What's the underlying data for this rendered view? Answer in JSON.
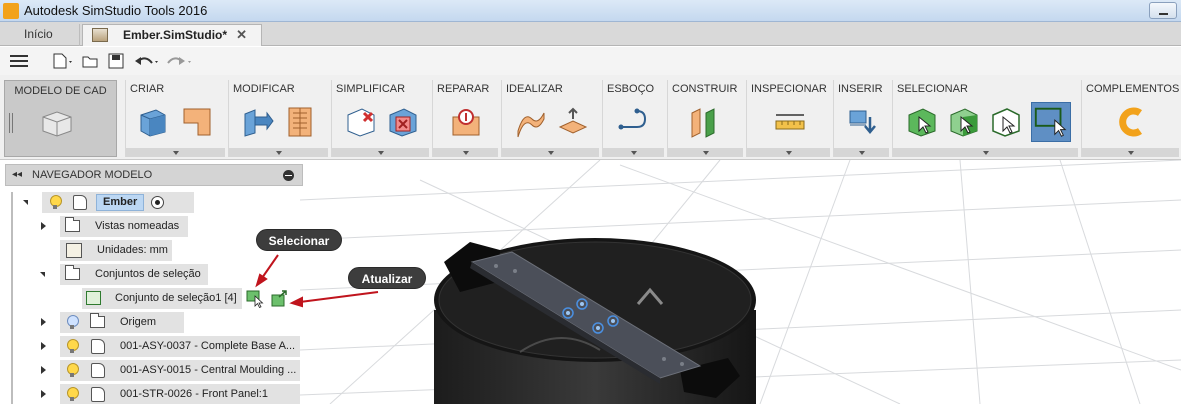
{
  "window": {
    "title": "Autodesk SimStudio Tools 2016"
  },
  "tabs": [
    {
      "label": "Início"
    },
    {
      "label": "Ember.SimStudio*",
      "close": "✕"
    }
  ],
  "quick_access": {
    "icons": [
      "menu-icon",
      "new-file-icon",
      "open-icon",
      "save-icon",
      "undo-icon",
      "redo-icon"
    ]
  },
  "ribbon": {
    "workspace": "MODELO DE CAD",
    "groups": [
      {
        "label": "CRIAR"
      },
      {
        "label": "MODIFICAR"
      },
      {
        "label": "SIMPLIFICAR"
      },
      {
        "label": "REPARAR"
      },
      {
        "label": "IDEALIZAR"
      },
      {
        "label": "ESBOÇO"
      },
      {
        "label": "CONSTRUIR"
      },
      {
        "label": "INSPECIONAR"
      },
      {
        "label": "INSERIR"
      },
      {
        "label": "SELECIONAR"
      },
      {
        "label": "COMPLEMENTOS"
      }
    ]
  },
  "browser": {
    "header": "NAVEGADOR MODELO",
    "root": "Ember",
    "named_views": "Vistas nomeadas",
    "units": "Unidades: mm",
    "selection_sets": "Conjuntos de seleção",
    "selection_set_item": "Conjunto de seleção1 [4]",
    "origin": "Origem",
    "components": [
      "001-ASY-0037 - Complete Base A...",
      "001-ASY-0015 - Central Moulding ...",
      "001-STR-0026 - Front Panel:1"
    ]
  },
  "callouts": {
    "select": "Selecionar",
    "update": "Atualizar"
  },
  "colors": {
    "accent_selected": "#5f8fc4",
    "callout_bg": "#3d3d3d",
    "arrow": "#c0141d"
  }
}
